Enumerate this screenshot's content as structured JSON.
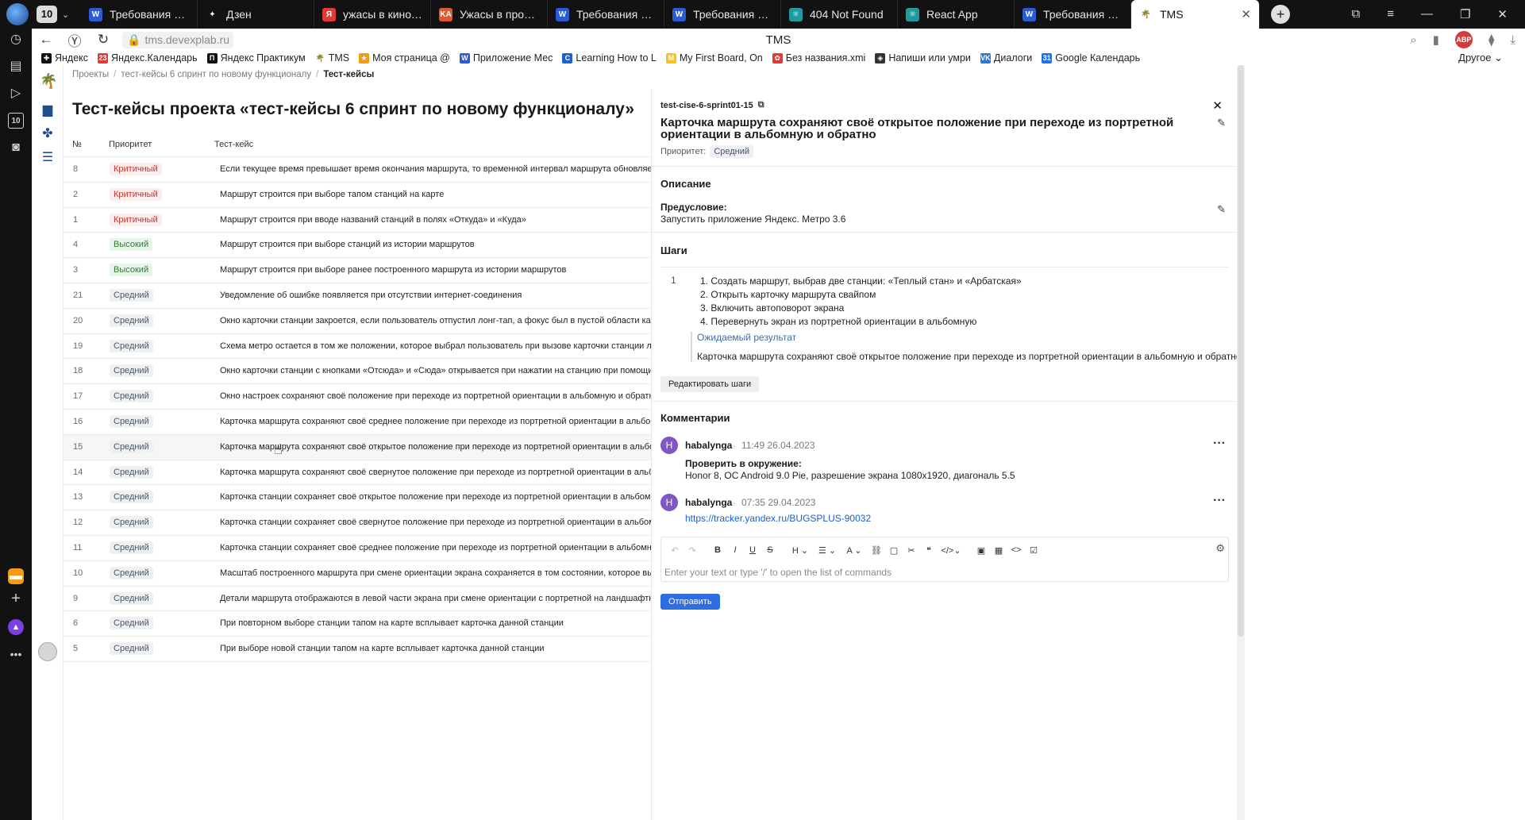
{
  "browser": {
    "tab_count": "10",
    "tabs": [
      {
        "label": "Требования к Янд",
        "icon": "W",
        "color": "#2b5ad6"
      },
      {
        "label": "Дзен",
        "icon": "✦",
        "color": "#111111"
      },
      {
        "label": "ужасы в кинотеат",
        "icon": "Я",
        "color": "#e53935"
      },
      {
        "label": "Ужасы в прокате",
        "icon": "KA",
        "color": "#e2572a"
      },
      {
        "label": "Требования к Янд",
        "icon": "W",
        "color": "#2b5ad6"
      },
      {
        "label": "Требования к рас",
        "icon": "W",
        "color": "#2b5ad6"
      },
      {
        "label": "404 Not Found",
        "icon": "⚛",
        "color": "#1f9aa0"
      },
      {
        "label": "React App",
        "icon": "⚛",
        "color": "#1f9aa0"
      },
      {
        "label": "Требования к Янд",
        "icon": "W",
        "color": "#2b5ad6"
      },
      {
        "label": "TMS",
        "icon": "🌴",
        "color": "#ffffff"
      }
    ],
    "url": "tms.devexplab.ru",
    "page_title": "TMS",
    "abp_label": "ABP",
    "bookmarks": [
      {
        "label": "Яндекс",
        "icon": "✚",
        "color": "#111111"
      },
      {
        "label": "Яндекс.Календарь",
        "icon": "23",
        "color": "#e53935"
      },
      {
        "label": "Яндекс Практикум",
        "icon": "П",
        "color": "#111111"
      },
      {
        "label": "TMS",
        "icon": "🌴",
        "color": "#ffffff"
      },
      {
        "label": "Моя страница @",
        "icon": "★",
        "color": "#f39c12"
      },
      {
        "label": "Приложение Мес",
        "icon": "W",
        "color": "#2b5ad6"
      },
      {
        "label": "Learning How to L",
        "icon": "C",
        "color": "#1f5fd6"
      },
      {
        "label": "My First Board, On",
        "icon": "M",
        "color": "#f7c51b"
      },
      {
        "label": "Без названия.xmi",
        "icon": "✿",
        "color": "#e53935"
      },
      {
        "label": "Напиши или умри",
        "icon": "◈",
        "color": "#333333"
      },
      {
        "label": "Диалоги",
        "icon": "VK",
        "color": "#2a78d6"
      },
      {
        "label": "Google Календарь",
        "icon": "31",
        "color": "#1e73e8"
      }
    ],
    "bookmarks_other": "Другое"
  },
  "breadcrumb": {
    "items": [
      "Проекты",
      "тест-кейсы 6 спринт по новому функционалу",
      "Тест-кейсы"
    ]
  },
  "page": {
    "heading": "Тест-кейсы проекта «тест-кейсы 6 спринт по новому функционалу»",
    "columns": {
      "num": "№",
      "priority": "Приоритет",
      "testcase": "Тест-кейс"
    }
  },
  "rows": [
    {
      "num": "8",
      "priority": "Критичный",
      "level": "crit",
      "title": "Если текущее время превышает время окончания маршрута, то временной интервал маршрута обновляется"
    },
    {
      "num": "2",
      "priority": "Критичный",
      "level": "crit",
      "title": "Маршрут строится при выборе тапом станций на карте"
    },
    {
      "num": "1",
      "priority": "Критичный",
      "level": "crit",
      "title": "Маршрут строится при вводе названий станций в полях «Откуда» и «Куда»"
    },
    {
      "num": "4",
      "priority": "Высокий",
      "level": "high",
      "title": "Маршрут строится при выборе станций из истории маршрутов"
    },
    {
      "num": "3",
      "priority": "Высокий",
      "level": "high",
      "title": "Маршрут строится при выборе ранее построенного маршрута из истории маршрутов"
    },
    {
      "num": "21",
      "priority": "Средний",
      "level": "mid",
      "title": "Уведомление об ошибке появляется при отсутствии интернет-соединения"
    },
    {
      "num": "20",
      "priority": "Средний",
      "level": "mid",
      "title": "Окно карточки станции закроется, если пользователь отпустил лонг-тап, а фокус был в пустой области карты"
    },
    {
      "num": "19",
      "priority": "Средний",
      "level": "mid",
      "title": "Схема метро остается в том же положении, которое выбрал пользователь при вызове карточки станции лонг-тапом"
    },
    {
      "num": "18",
      "priority": "Средний",
      "level": "mid",
      "title": "Окно карточки станции с кнопками «Отсюда» и «Сюда» открывается при нажатии на станцию при помощи лонг-тапа"
    },
    {
      "num": "17",
      "priority": "Средний",
      "level": "mid",
      "title": "Окно настроек сохраняют своё положение при переходе из портретной ориентации в альбомную и обратно"
    },
    {
      "num": "16",
      "priority": "Средний",
      "level": "mid",
      "title": "Карточка маршрута сохраняют своё среднее положение при переходе из портретной ориентации в альбомную и обратно"
    },
    {
      "num": "15",
      "priority": "Средний",
      "level": "mid",
      "title": "Карточка маршрута сохраняют своё открытое положение при переходе из портретной ориентации в альбомную и обратно"
    },
    {
      "num": "14",
      "priority": "Средний",
      "level": "mid",
      "title": "Карточка маршрута сохраняют своё свернутое положение при переходе из портретной ориентации в альбомную и обратно"
    },
    {
      "num": "13",
      "priority": "Средний",
      "level": "mid",
      "title": "Карточка станции сохраняет своё открытое положение при переходе из портретной ориентации в альбомную и обратно"
    },
    {
      "num": "12",
      "priority": "Средний",
      "level": "mid",
      "title": "Карточка станции сохраняет своё свернутое положение при переходе из портретной ориентации в альбомную и обратно"
    },
    {
      "num": "11",
      "priority": "Средний",
      "level": "mid",
      "title": "Карточка станции сохраняет своё среднее положение при переходе из портретной ориентации в альбомную и обратно"
    },
    {
      "num": "10",
      "priority": "Средний",
      "level": "mid",
      "title": "Масштаб построенного маршрута при смене ориентации экрана сохраняется в том состоянии, которое выбрал пользователь"
    },
    {
      "num": "9",
      "priority": "Средний",
      "level": "mid",
      "title": "Детали маршрута отображаются в левой части экрана при смене ориентации с портретной на ландшафтную."
    },
    {
      "num": "6",
      "priority": "Средний",
      "level": "mid",
      "title": "При повторном выборе станции тапом на карте всплывает карточка данной станции"
    },
    {
      "num": "5",
      "priority": "Средний",
      "level": "mid",
      "title": "При выборе новой станции тапом на карте всплывает карточка данной станции"
    }
  ],
  "detail": {
    "id": "test-cise-6-sprint01-15",
    "title": "Карточка маршрута сохраняют своё открытое положение при переходе из портретной ориентации в альбомную и обратно",
    "priority_label": "Приоритет:",
    "priority": "Средний",
    "description_h": "Описание",
    "precondition_label": "Предусловие:",
    "precondition": "Запустить приложение Яндекс. Метро 3.6",
    "steps_h": "Шаги",
    "step_num": "1",
    "steps": [
      "1. Создать маршрут, выбрав две станции: «Теплый стан» и «Арбатская»",
      "2. Открыть карточку маршрута свайпом",
      "3. Включить автоповорот экрана",
      "4. Перевернуть экран из портретной ориентации в альбомную"
    ],
    "expected_label": "Ожидаемый результат",
    "expected": "Карточка маршрута сохраняют своё открытое положение при переходе из портретной ориентации в альбомную и обратно",
    "edit_steps": "Редактировать шаги",
    "comments_h": "Комментарии",
    "comments": [
      {
        "initial": "H",
        "author": "habalynga",
        "time": "11:49 26.04.2023",
        "bold": "Проверить в окружение:",
        "text": "Honor 8, OC Android 9.0 Pie, разрешение экрана 1080x1920, диагональ 5.5"
      },
      {
        "initial": "H",
        "author": "habalynga",
        "time": "07:35 29.04.2023",
        "link": "https://tracker.yandex.ru/BUGSPLUS-90032"
      }
    ],
    "editor_placeholder": "Enter your text or type '/' to open the list of commands",
    "send": "Отправить"
  }
}
